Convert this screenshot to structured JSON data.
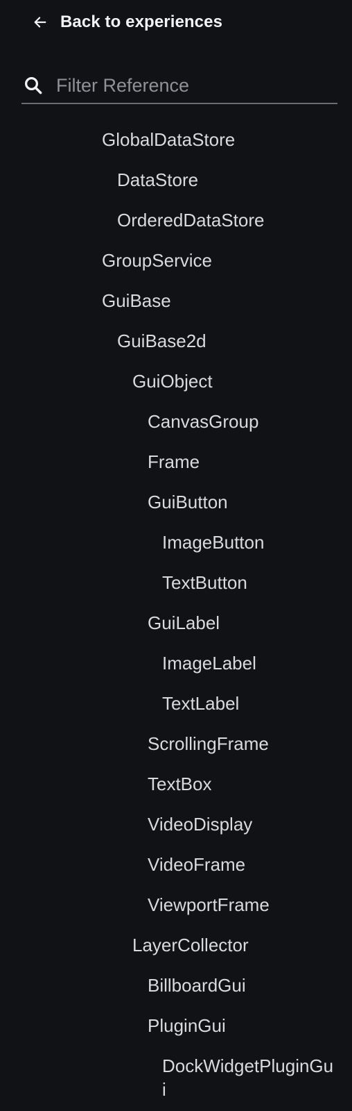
{
  "header": {
    "back_label": "Back to experiences",
    "back_icon": "arrow-left-icon"
  },
  "search": {
    "placeholder": "Filter Reference",
    "value": "",
    "icon": "search-icon"
  },
  "tree": {
    "items": [
      {
        "label": "GlobalDataStore",
        "depth": 0
      },
      {
        "label": "DataStore",
        "depth": 1
      },
      {
        "label": "OrderedDataStore",
        "depth": 1
      },
      {
        "label": "GroupService",
        "depth": 0
      },
      {
        "label": "GuiBase",
        "depth": 0
      },
      {
        "label": "GuiBase2d",
        "depth": 1
      },
      {
        "label": "GuiObject",
        "depth": 2
      },
      {
        "label": "CanvasGroup",
        "depth": 3
      },
      {
        "label": "Frame",
        "depth": 3
      },
      {
        "label": "GuiButton",
        "depth": 3
      },
      {
        "label": "ImageButton",
        "depth": 4
      },
      {
        "label": "TextButton",
        "depth": 4
      },
      {
        "label": "GuiLabel",
        "depth": 3
      },
      {
        "label": "ImageLabel",
        "depth": 4
      },
      {
        "label": "TextLabel",
        "depth": 4
      },
      {
        "label": "ScrollingFrame",
        "depth": 3
      },
      {
        "label": "TextBox",
        "depth": 3
      },
      {
        "label": "VideoDisplay",
        "depth": 3
      },
      {
        "label": "VideoFrame",
        "depth": 3
      },
      {
        "label": "ViewportFrame",
        "depth": 3
      },
      {
        "label": "LayerCollector",
        "depth": 2
      },
      {
        "label": "BillboardGui",
        "depth": 3
      },
      {
        "label": "PluginGui",
        "depth": 3
      },
      {
        "label": "DockWidgetPluginGui",
        "depth": 4
      }
    ]
  },
  "colors": {
    "background": "#111216",
    "text": "#d9dadc",
    "placeholder": "#8f9196",
    "divider": "#6b6d73"
  }
}
